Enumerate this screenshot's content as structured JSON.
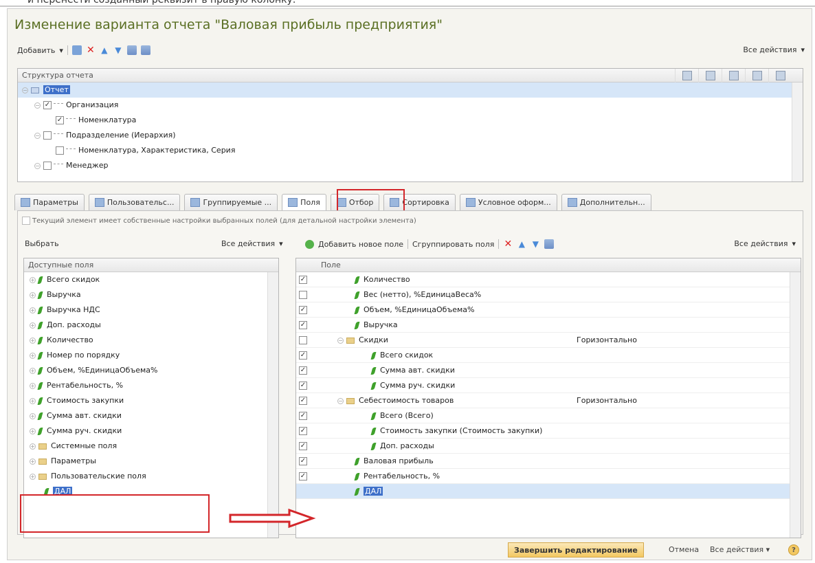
{
  "topline": "и перенести созданный реквизит в правую колонку.",
  "title": "Изменение варианта отчета \"Валовая прибыль предприятия\"",
  "toolbar": {
    "add_label": "Добавить",
    "all_actions": "Все действия"
  },
  "structure": {
    "header": "Структура отчета",
    "rows": [
      {
        "label": "Отчет",
        "level": 0,
        "selected": true,
        "checked": null
      },
      {
        "label": "Организация",
        "level": 1,
        "selected": false,
        "checked": true
      },
      {
        "label": "Номенклатура",
        "level": 2,
        "selected": false,
        "checked": true
      },
      {
        "label": "Подразделение (Иерархия)",
        "level": 1,
        "selected": false,
        "checked": false
      },
      {
        "label": "Номенклатура, Характеристика, Серия",
        "level": 2,
        "selected": false,
        "checked": false
      },
      {
        "label": "Менеджер",
        "level": 1,
        "selected": false,
        "checked": false
      }
    ]
  },
  "tabs": [
    {
      "label": "Параметры"
    },
    {
      "label": "Пользовательс..."
    },
    {
      "label": "Группируемые ..."
    },
    {
      "label": "Поля"
    },
    {
      "label": "Отбор"
    },
    {
      "label": "Сортировка"
    },
    {
      "label": "Условное оформ..."
    },
    {
      "label": "Дополнительн..."
    }
  ],
  "own_settings_label": "Текущий элемент имеет собственные настройки выбранных полей (для детальной настройки элемента)",
  "left": {
    "choose_label": "Выбрать",
    "all_actions": "Все действия",
    "header": "Доступные поля",
    "items": [
      {
        "label": "Всего скидок",
        "kind": "field"
      },
      {
        "label": "Выручка",
        "kind": "field"
      },
      {
        "label": "Выручка НДС",
        "kind": "field"
      },
      {
        "label": "Доп. расходы",
        "kind": "field"
      },
      {
        "label": "Количество",
        "kind": "field"
      },
      {
        "label": "Номер по порядку",
        "kind": "field"
      },
      {
        "label": "Объем, %ЕдиницаОбъема%",
        "kind": "field"
      },
      {
        "label": "Рентабельность, %",
        "kind": "field"
      },
      {
        "label": "Стоимость закупки",
        "kind": "field"
      },
      {
        "label": "Сумма авт. скидки",
        "kind": "field"
      },
      {
        "label": "Сумма руч. скидки",
        "kind": "field"
      },
      {
        "label": "Системные поля",
        "kind": "folder"
      },
      {
        "label": "Параметры",
        "kind": "folder"
      },
      {
        "label": "Пользовательские поля",
        "kind": "folder"
      },
      {
        "label": "ДАЛ",
        "kind": "selected-leaf"
      }
    ]
  },
  "right": {
    "add_new_field": "Добавить новое поле",
    "group_fields": "Сгруппировать поля",
    "all_actions": "Все действия",
    "header": "Поле",
    "rows": [
      {
        "label": "Количество",
        "checked": true,
        "indent": 1,
        "kind": "field",
        "extra": ""
      },
      {
        "label": "Вес (нетто), %ЕдиницаВеса%",
        "checked": false,
        "indent": 1,
        "kind": "field",
        "extra": ""
      },
      {
        "label": "Объем, %ЕдиницаОбъема%",
        "checked": true,
        "indent": 1,
        "kind": "field",
        "extra": ""
      },
      {
        "label": "Выручка",
        "checked": true,
        "indent": 1,
        "kind": "field",
        "extra": ""
      },
      {
        "label": "Скидки",
        "checked": false,
        "indent": 1,
        "kind": "folder",
        "extra": "Горизонтально"
      },
      {
        "label": "Всего скидок",
        "checked": true,
        "indent": 2,
        "kind": "field",
        "extra": ""
      },
      {
        "label": "Сумма авт. скидки",
        "checked": true,
        "indent": 2,
        "kind": "field",
        "extra": ""
      },
      {
        "label": "Сумма руч. скидки",
        "checked": true,
        "indent": 2,
        "kind": "field",
        "extra": ""
      },
      {
        "label": "Себестоимость товаров",
        "checked": true,
        "indent": 1,
        "kind": "folder",
        "extra": "Горизонтально"
      },
      {
        "label": "Всего (Всего)",
        "checked": true,
        "indent": 2,
        "kind": "field",
        "extra": ""
      },
      {
        "label": "Стоимость закупки (Стоимость закупки)",
        "checked": true,
        "indent": 2,
        "kind": "field",
        "extra": ""
      },
      {
        "label": "Доп. расходы",
        "checked": true,
        "indent": 2,
        "kind": "field",
        "extra": ""
      },
      {
        "label": "Валовая прибыль",
        "checked": true,
        "indent": 1,
        "kind": "field",
        "extra": ""
      },
      {
        "label": "Рентабельность, %",
        "checked": true,
        "indent": 1,
        "kind": "field",
        "extra": ""
      },
      {
        "label": "ДАЛ",
        "checked": null,
        "indent": 1,
        "kind": "selected",
        "extra": ""
      }
    ]
  },
  "footer": {
    "finish": "Завершить редактирование",
    "cancel": "Отмена",
    "all_actions": "Все действия",
    "help": "?"
  },
  "colors": {
    "title": "#5a6f23",
    "selection": "#d6e6f8",
    "highlight": "#d3262a"
  }
}
